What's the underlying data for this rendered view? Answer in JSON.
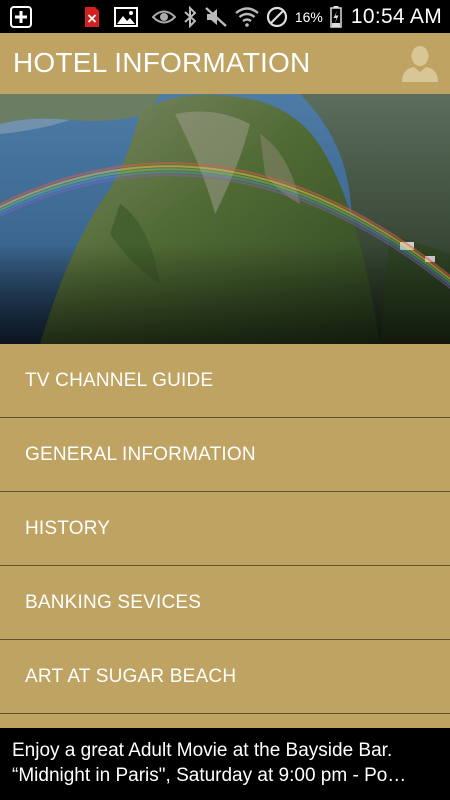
{
  "status_bar": {
    "time": "10:54 AM",
    "battery_percent": "16%",
    "icons": [
      "add-icon",
      "pdf-file-icon",
      "image-icon",
      "eye-icon",
      "bluetooth-icon",
      "mute-icon",
      "wifi-icon",
      "no-sync-icon",
      "battery-charging-icon"
    ]
  },
  "header": {
    "title": "HOTEL INFORMATION",
    "profile_icon": "person-icon",
    "background_color": "#bfa362"
  },
  "hero": {
    "image": "aerial photo of a forested volcanic peak with a rainbow over the sea"
  },
  "menu": {
    "items": [
      {
        "label": "TV CHANNEL GUIDE"
      },
      {
        "label": "GENERAL INFORMATION"
      },
      {
        "label": "HISTORY"
      },
      {
        "label": "BANKING SEVICES"
      },
      {
        "label": "ART AT SUGAR BEACH"
      }
    ]
  },
  "ticker": {
    "line1": "Enjoy a great Adult Movie at the Bayside Bar.",
    "line2": "“Midnight in Paris\", Saturday at 9:00 pm - Po…"
  }
}
